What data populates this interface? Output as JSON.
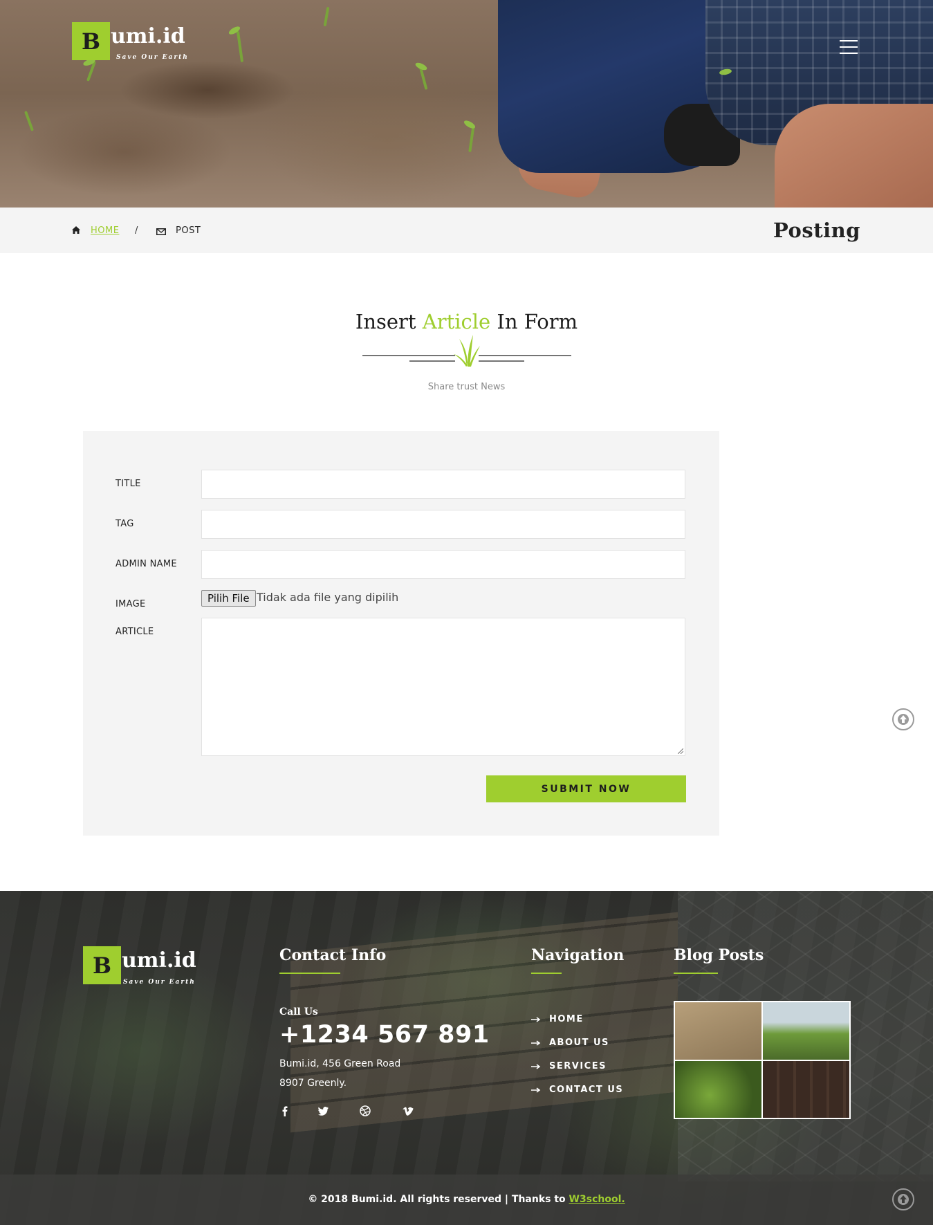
{
  "brand": {
    "logo_letter": "B",
    "logo_rest": "umi.id",
    "tagline": "Save Our Earth"
  },
  "breadcrumb": {
    "home": "HOME",
    "separator": "/",
    "current": "POST"
  },
  "page_title": "Posting",
  "section": {
    "title_before": "Insert ",
    "title_accent": "Article",
    "title_after": " In Form",
    "subtitle": "Share trust News"
  },
  "form": {
    "title_label": "TITLE",
    "tag_label": "TAG",
    "admin_label": "ADMIN NAME",
    "image_label": "IMAGE",
    "article_label": "ARTICLE",
    "file_button": "Pilih File",
    "file_status": "Tidak ada file yang dipilih",
    "submit": "SUBMIT NOW"
  },
  "footer": {
    "contact_heading": "Contact Info",
    "call_label": "Call Us",
    "phone": "+1234 567 891",
    "address_line1": "Bumi.id, 456 Green Road",
    "address_line2": "8907 Greenly.",
    "nav_heading": "Navigation",
    "nav_items": [
      "HOME",
      "ABOUT US",
      "SERVICES",
      "CONTACT US"
    ],
    "blog_heading": "Blog Posts",
    "social_icons": [
      "facebook-icon",
      "twitter-icon",
      "dribbble-icon",
      "vimeo-icon"
    ],
    "copyright_text": "© 2018 Bumi.id. All rights reserved | Thanks to ",
    "copyright_link": "W3school."
  },
  "colors": {
    "accent": "#9fce2f",
    "panel": "#f4f4f4",
    "text": "#222222"
  }
}
